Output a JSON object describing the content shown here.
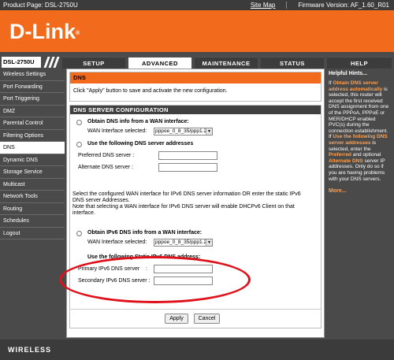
{
  "topbar": {
    "product": "Product Page: DSL-2750U",
    "site_map": "Site Map",
    "firmware": "Firmware Version: AF_1.60_R01"
  },
  "logo": {
    "text": "D-Link",
    "mark": "®"
  },
  "model": "DSL-2750U",
  "tabs": [
    "SETUP",
    "ADVANCED",
    "MAINTENANCE",
    "STATUS"
  ],
  "help_tab": "HELP",
  "sidebar": {
    "items": [
      "Wireless Settings",
      "Port Forwarding",
      "Port Triggering",
      "DMZ",
      "Parental Control",
      "Filtering Options",
      "DNS",
      "Dynamic DNS",
      "Storage Service",
      "Multicast",
      "Network Tools",
      "Routing",
      "Schedules",
      "Logout"
    ],
    "active": "DNS"
  },
  "dns": {
    "title": "DNS",
    "description": "Click \"Apply\" button to save and activate the new configuration."
  },
  "config": {
    "title": "DNS SERVER CONFIGURATION",
    "obtain_wan_label": "Obtain DNS info from a WAN interface:",
    "wan_selected_label": "WAN Interface selected:",
    "wan_selected_value": "pppoe_0_8_35/ppp1.2",
    "use_following_label": "Use the following DNS server addresses",
    "preferred_label": "Preferred DNS server :",
    "alternate_label": "Alternate DNS server :",
    "ipv6_note_1": "Select the configured WAN interface for IPv6 DNS server information OR enter the static IPv6",
    "ipv6_note_2": "DNS server Addresses.",
    "ipv6_note_3": "Note that selecting a WAN interface for IPv6 DNS server will enable DHCPv6 Client on that",
    "ipv6_note_4": "interface.",
    "obtain_ipv6_label": "Obtain IPv6 DNS info from a WAN interface:",
    "ipv6_wan_selected_label": "WAN Interface selected:",
    "ipv6_wan_selected_value": "pppoe_0_8_35/ppp1.2",
    "static_ipv6_label": "Use the following Static IPv6 DNS address:",
    "primary_ipv6_label": "Primary IPv6 DNS server",
    "secondary_ipv6_label": "Secondary IPv6 DNS server :",
    "primary_ipv6_colon": ":",
    "apply": "Apply",
    "cancel": "Cancel"
  },
  "help": {
    "title": "Helpful Hints...",
    "p1_pre": "If ",
    "p1_hl": "Obtain DNS server address automatically",
    "p1_post": " is selected, this router will accept the first received DNS assignment from one of the PPPoA, PPPoE or MER/DHCP enabled PVC(s) during the connection establishment. If ",
    "p2_hl": "Use the following DNS server addresses",
    "p2_post": " is selected, enter the ",
    "p3_hl": "Preferred",
    "p3_post": " and optional ",
    "p4_hl": "Alternate DNS",
    "p4_post": " server IP addresses. Only do so if you are having problems with your DNS servers.",
    "more": "More..."
  },
  "footer": "WIRELESS",
  "colors": {
    "accent": "#f26b1d",
    "dark": "#4a4a4a",
    "annotation": "#e0101a"
  }
}
